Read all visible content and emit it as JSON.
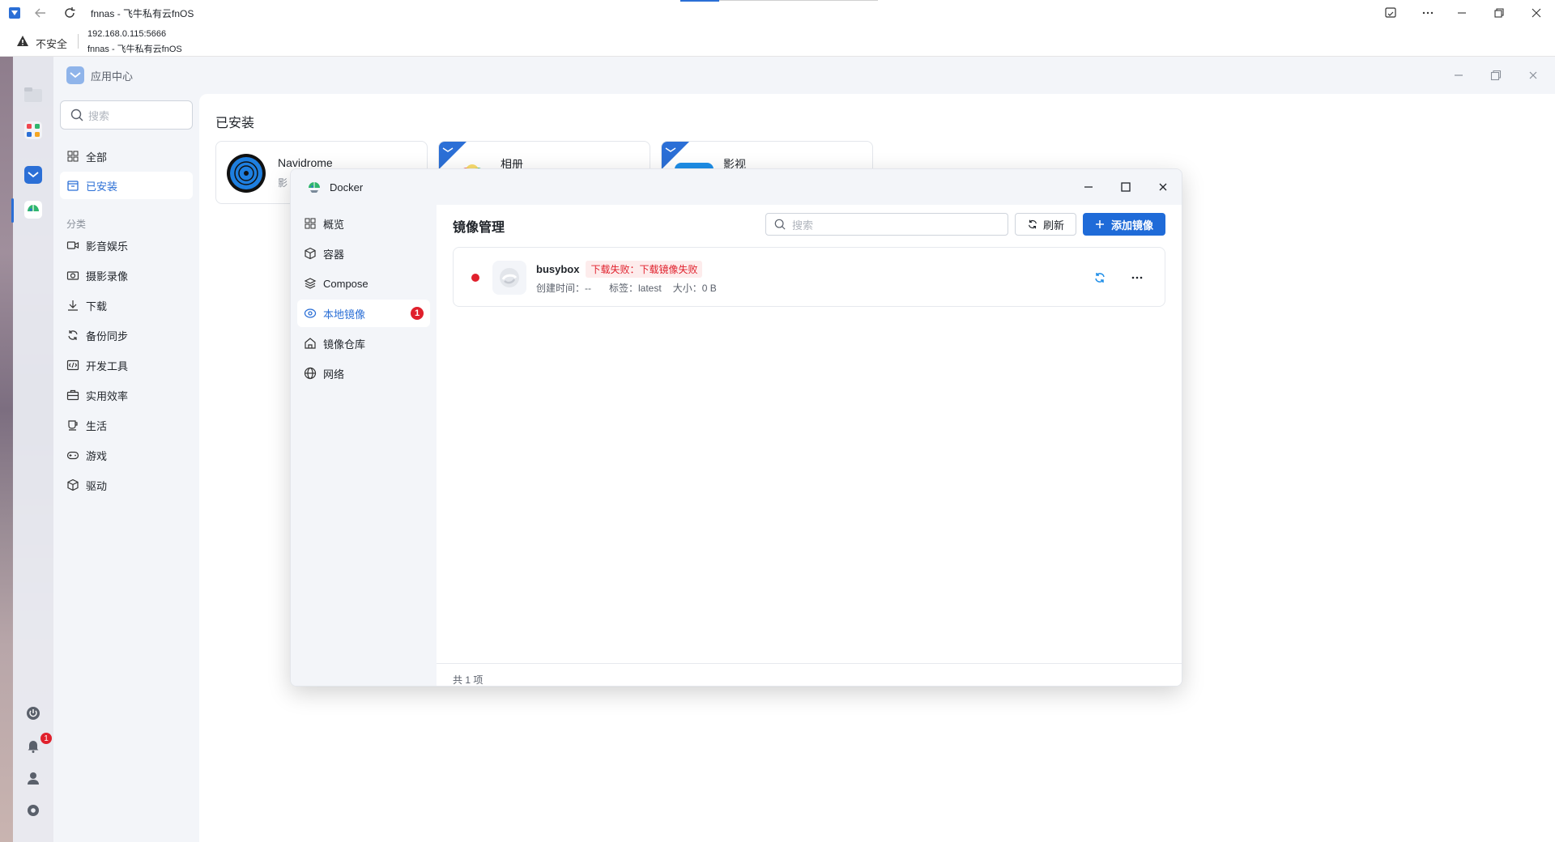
{
  "browser": {
    "tab_title": "fnnas - 飞牛私有云fnOS",
    "security_label": "不安全",
    "url": "192.168.0.115:5666",
    "page_title": "fnnas - 飞牛私有云fnOS"
  },
  "dock": {
    "notification_count": "1"
  },
  "app_center": {
    "title": "应用中心",
    "search_placeholder": "搜索",
    "nav": [
      {
        "label": "全部"
      },
      {
        "label": "已安装"
      }
    ],
    "category_heading": "分类",
    "categories": [
      {
        "label": "影音娱乐"
      },
      {
        "label": "摄影录像"
      },
      {
        "label": "下载"
      },
      {
        "label": "备份同步"
      },
      {
        "label": "开发工具"
      },
      {
        "label": "实用效率"
      },
      {
        "label": "生活"
      },
      {
        "label": "游戏"
      },
      {
        "label": "驱动"
      }
    ],
    "installed_heading": "已安装",
    "apps": [
      {
        "name": "Navidrome",
        "desc": "影"
      },
      {
        "name": "相册"
      },
      {
        "name": "影视"
      }
    ]
  },
  "docker": {
    "title": "Docker",
    "nav": [
      {
        "label": "概览"
      },
      {
        "label": "容器"
      },
      {
        "label": "Compose"
      },
      {
        "label": "本地镜像",
        "badge": "1"
      },
      {
        "label": "镜像仓库"
      },
      {
        "label": "网络"
      }
    ],
    "page_title": "镜像管理",
    "search_placeholder": "搜索",
    "refresh_label": "刷新",
    "add_label": "添加镜像",
    "images": [
      {
        "name": "busybox",
        "error": "下载失败：下载镜像失败",
        "created_label": "创建时间：--",
        "tag_label": "标签：latest",
        "size_label": "大小：0 B",
        "status_color": "#e0202c"
      }
    ],
    "footer": "共 1 项"
  }
}
